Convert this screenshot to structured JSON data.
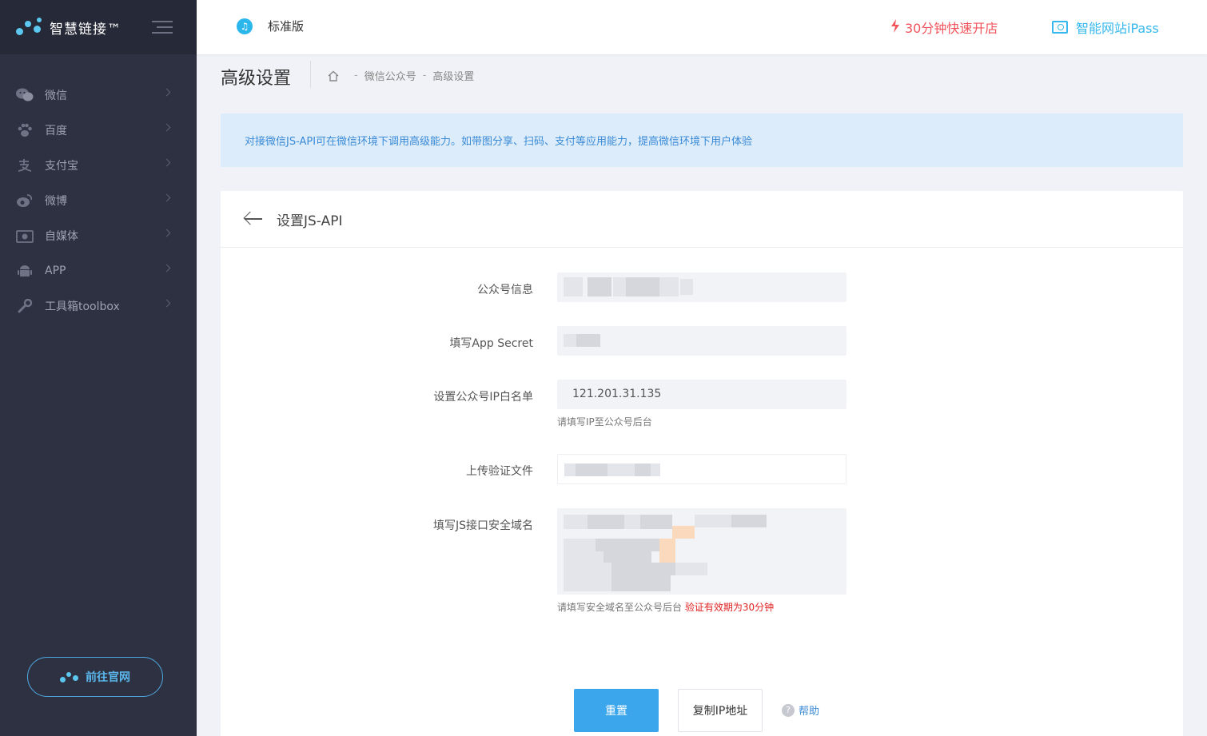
{
  "brand": {
    "name": "智慧链接™"
  },
  "sidebar": {
    "items": [
      {
        "label": "微信",
        "icon": "wechat-icon"
      },
      {
        "label": "百度",
        "icon": "paw-icon"
      },
      {
        "label": "支付宝",
        "icon": "alipay-icon"
      },
      {
        "label": "微博",
        "icon": "weibo-icon"
      },
      {
        "label": "自媒体",
        "icon": "camera-icon"
      },
      {
        "label": "APP",
        "icon": "android-icon"
      },
      {
        "label": "工具箱toolbox",
        "icon": "wrench-icon"
      }
    ],
    "visit_label": "前往官网"
  },
  "header": {
    "edition": "标准版",
    "quick_open": "30分钟快速开店",
    "ipass": "智能网站iPass"
  },
  "page": {
    "title": "高级设置",
    "breadcrumb": [
      "微信公众号",
      "高级设置"
    ]
  },
  "notice": "对接微信JS-API可在微信环境下调用高级能力。如带图分享、扫码、支付等应用能力，提高微信环境下用户体验",
  "card": {
    "title": "设置JS-API",
    "fields": {
      "account_label": "公众号信息",
      "secret_label": "填写App Secret",
      "ip_label": "设置公众号IP白名单",
      "ip_value": "121.201.31.135",
      "ip_hint": "请填写IP至公众号后台",
      "upload_label": "上传验证文件",
      "domain_label": "填写JS接口安全域名",
      "domain_hint": "请填写安全域名至公众号后台",
      "domain_warn": "验证有效期为30分钟"
    },
    "buttons": {
      "reset": "重置",
      "copy_ip": "复制IP地址",
      "help": "帮助"
    }
  },
  "colors": {
    "sidebar_bg": "#2e3142",
    "accent": "#3ba6ec",
    "warn": "#e02020",
    "promo": "#f2545b"
  }
}
